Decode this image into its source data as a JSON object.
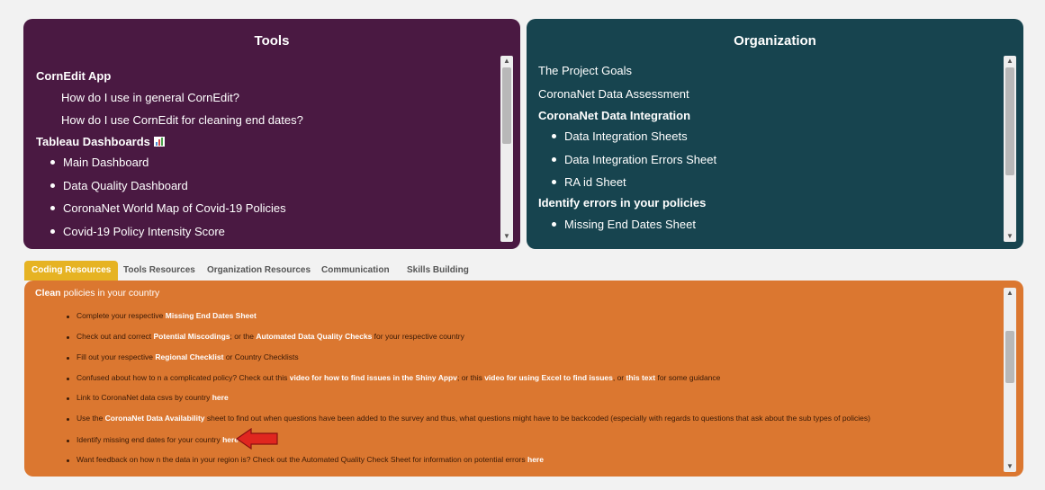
{
  "tools": {
    "title": "Tools",
    "cornedit_heading": "CornEdit App",
    "cornedit_items": [
      "How do I use in general CornEdit?",
      "How do I use CornEdit for cleaning end dates?"
    ],
    "tableau_heading": "Tableau Dashboards",
    "tableau_items": [
      "Main Dashboard",
      "Data Quality Dashboard",
      "CoronaNet World Map of Covid-19 Policies",
      "Covid-19 Policy Intensity Score"
    ]
  },
  "organization": {
    "title": "Organization",
    "project_goals": "The Project Goals",
    "data_assessment": "CoronaNet Data Assessment",
    "integration_heading": "CoronaNet Data Integration",
    "integration_items": [
      "Data Integration Sheets",
      "Data Integration Errors Sheet",
      "RA id Sheet"
    ],
    "errors_heading": "Identify errors in your policies",
    "errors_items": [
      "Missing End Dates Sheet"
    ]
  },
  "tabs": [
    "Coding Resources",
    "Tools Resources",
    "Organization Resources",
    "Communication",
    "Skills Building"
  ],
  "coding": {
    "heading_bold": "Clean",
    "heading_rest": " policies in your country",
    "items": [
      {
        "p1": "Complete your respective ",
        "l1": "Missing End Dates Sheet"
      },
      {
        "p1": "Check out and correct ",
        "l1": "Potential Miscodings",
        "p2": "; or the ",
        "l2": "Automated Data Quality Checks",
        "p3": " for your respective country"
      },
      {
        "p1": "Fill out your respective ",
        "l1": "Regional Checklist",
        "p2": " or Country Checklists"
      },
      {
        "p1": "Confused about how to n a complicated policy? Check out this ",
        "l1": "video for how to find issues in the Shiny Appv",
        "p2": "; or this ",
        "l2": "video for using Excel to find issues",
        "p3": ", or ",
        "l3": "this text",
        "p4": " for some guidance"
      },
      {
        "p1": "Link to CoronaNet data csvs by country ",
        "l1": "here"
      },
      {
        "p1": "Use the ",
        "l1": "CoronaNet Data Availability",
        "p2": " sheet to find out when questions have been added to the survey and thus, what questions might have to be backcoded (especially with regards to questions that ask about the sub types of policies)"
      },
      {
        "p1": "Identify missing end dates for your country ",
        "l1": "here"
      },
      {
        "p1": "Want feedback on how n the data in your region is? Check out the Automated Quality Check Sheet for information on potential errors ",
        "l1": "here"
      }
    ]
  },
  "colors": {
    "tools_bg": "#4a1942",
    "org_bg": "#17444f",
    "coding_bg": "#db7730",
    "tab_active": "#e6b323",
    "arrow": "#e0261f"
  }
}
